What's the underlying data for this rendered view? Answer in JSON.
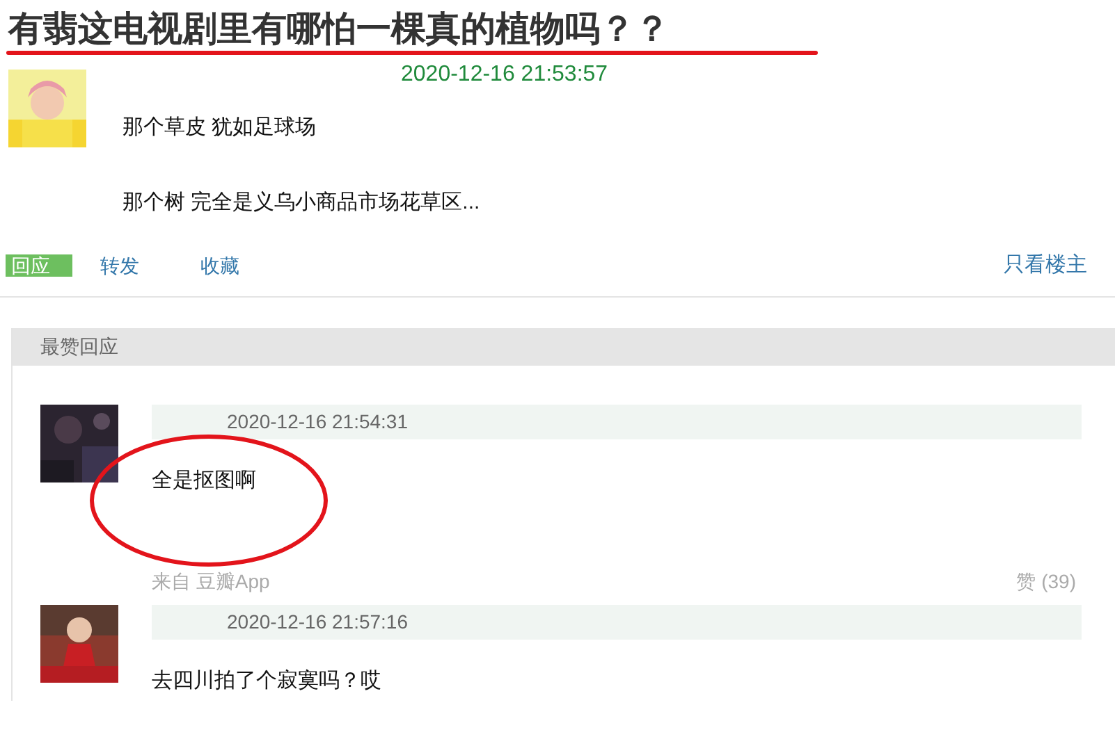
{
  "title": "有翡这电视剧里有哪怕一棵真的植物吗？？",
  "post": {
    "avatar": {
      "kind": "picture"
    },
    "time": "2020-12-16 21:53:57",
    "paragraphs": [
      "那个草皮 犹如足球场",
      "那个树 完全是义乌小商品市场花草区..."
    ],
    "actions": [
      {
        "kind": "badge",
        "label": "回应"
      },
      {
        "kind": "link",
        "label": "转发"
      },
      {
        "kind": "link",
        "label": "收藏"
      }
    ],
    "author_only": "只看楼主"
  },
  "best_replies": {
    "heading": "最赞回应",
    "replies": [
      {
        "avatar": {
          "kind": "picture"
        },
        "time": "2020-12-16 21:54:31",
        "text": "全是抠图啊",
        "source": "来自 豆瓣App",
        "likes": "赞 (39)"
      },
      {
        "avatar": {
          "kind": "picture"
        },
        "time": "2020-12-16 21:57:16",
        "text": "去四川拍了个寂寞吗？哎"
      }
    ]
  }
}
